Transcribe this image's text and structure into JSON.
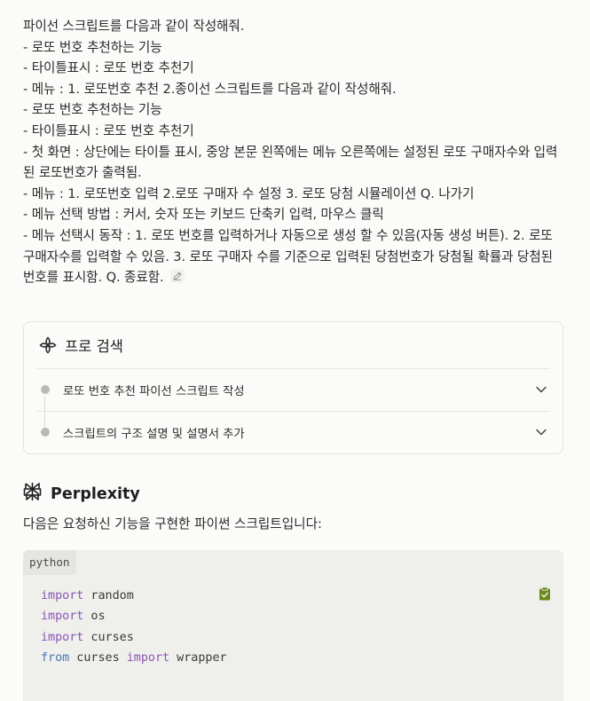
{
  "query": {
    "lines": [
      "파이선 스크립트를 다음과 같이 작성해줘.",
      "- 로또 번호 추천하는 기능",
      "- 타이틀표시 : 로또 번호 추천기",
      "- 메뉴 : 1. 로또번호 추천 2.종이선 스크립트를 다음과 같이 작성해줘.",
      "- 로또 번호 추천하는 기능",
      "- 타이틀표시 : 로또 번호 추천기",
      "- 첫 화면 : 상단에는 타이틀 표시, 중앙 본문 왼쪽에는 메뉴 오른쪽에는 설정된 로또 구매자수와 입력된 로또번호가 출력됨.",
      "- 메뉴 : 1. 로또번호 입력 2.로또 구매자 수 설정 3. 로또 당첨 시뮬레이션 Q. 나가기",
      "- 메뉴 선택 방법 : 커서, 숫자 또는 키보드 단축키 입력, 마우스 클릭",
      "- 메뉴 선택시 동작 : 1. 로또 번호를 입력하거나 자동으로 생성 할 수 있음(자동 생성 버튼).  2. 로또 구매자수를 입력할 수 있음. 3. 로또 구매자 수를 기준으로 입력된 당첨번호가 당첨될 확률과 당첨된 번호를 표시함. Q. 종료함."
    ],
    "edit_icon": "pencil-edit-icon"
  },
  "pro_search": {
    "title": "프로 검색",
    "icon": "pro-search-icon",
    "steps": [
      {
        "label": "로또 번호 추천 파이선 스크립트 작성"
      },
      {
        "label": "스크립트의 구조 설명 및 설명서 추가"
      }
    ]
  },
  "answer": {
    "source_name": "Perplexity",
    "logo_icon": "perplexity-logo-icon",
    "intro": "다음은 요청하신 기능을 구현한 파이썬 스크립트입니다:",
    "code": {
      "language": "python",
      "lines": [
        {
          "kw": "import",
          "rest": " random"
        },
        {
          "kw": "import",
          "rest": " os"
        },
        {
          "kw": "import",
          "rest": " curses"
        },
        {
          "kw": "from",
          "mid": " curses ",
          "kw_b": "import",
          "rest": " wrapper"
        }
      ],
      "copy_icon": "clipboard-check-icon"
    }
  },
  "colors": {
    "background": "#fbfbf9",
    "keyword_purple": "#8a55b8",
    "keyword_blue": "#4a78b0",
    "copy_icon_green": "#6b8a1d"
  }
}
